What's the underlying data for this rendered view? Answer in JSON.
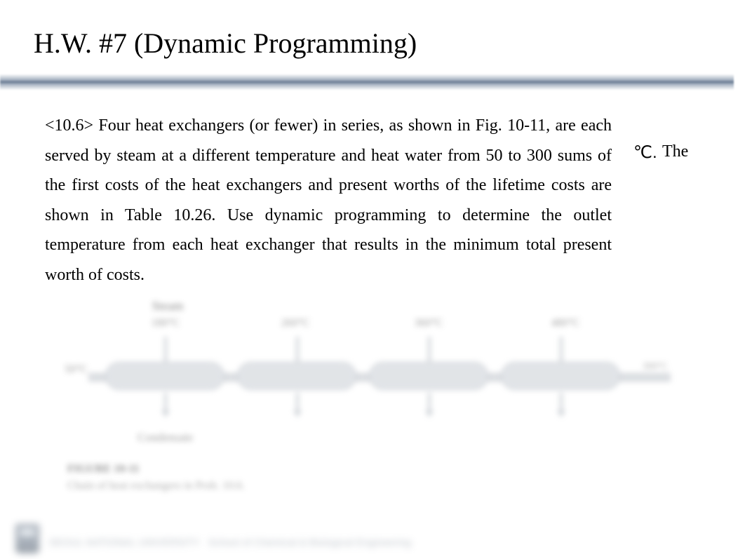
{
  "title": "H.W. #7 (Dynamic Programming)",
  "body_text": "<10.6> Four heat exchangers (or fewer) in series, as shown in Fig. 10-11, are each served by steam at a different temperature and heat water from 50 to 300                 sums of the first costs of the heat exchangers and present worths of the lifetime costs are shown in Table 10.26. Use dynamic programming to determine the outlet temperature from each heat exchanger that results in the minimum total present worth of costs.",
  "degree_unit": "℃.",
  "trailing_word": "The",
  "diagram": {
    "steam_label": "Steam",
    "inlet_label": "50°C",
    "temps": [
      "180°C",
      "260°C",
      "360°C",
      "480°C"
    ],
    "condensate_label": "Condensate",
    "outlet_label": "300°C",
    "figure_title": "FIGURE 10-11",
    "figure_caption": "Chain of heat exchangers in Prob. 10.6."
  },
  "footer": {
    "institution": "SEOUL NATIONAL UNIVERSITY",
    "department": "School of Chemical & Biological Engineering"
  }
}
